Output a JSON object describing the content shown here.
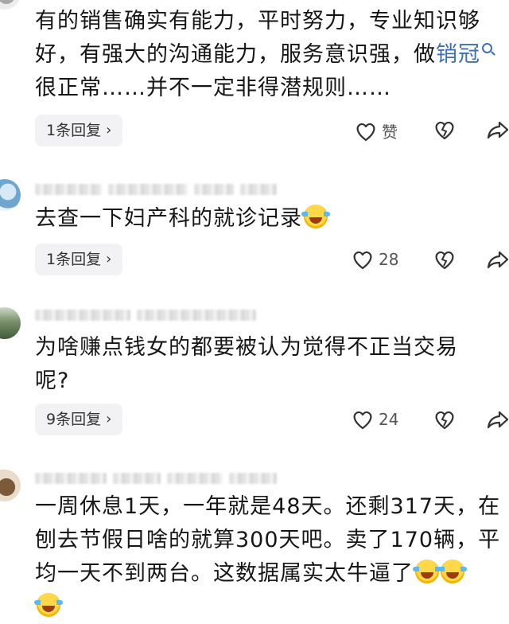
{
  "comments": [
    {
      "text_before_link": "有的销售确实有能力，平时努力，专业知识够好，有强大的沟通能力，服务意识强，做",
      "link_text": "销冠",
      "text_after_link": "很正常……并不一定非得潜规则……",
      "reply_label": "1条回复",
      "like_label": "赞"
    },
    {
      "text": "去查一下妇产科的就诊记录",
      "reply_label": "1条回复",
      "like_count": "28"
    },
    {
      "text": "为啥赚点钱女的都要被认为觉得不正当交易呢?",
      "reply_label": "9条回复",
      "like_count": "24"
    },
    {
      "text": "一周休息1天，一年就是48天。还剩317天，在刨去节假日啥的就算300天吧。卖了170辆，平均一天不到两台。这数据属实太牛逼了"
    }
  ],
  "icons": {
    "like": "heart-outline-icon",
    "dislike": "broken-heart-icon",
    "share": "share-arrow-icon",
    "reply_chevron": "chevron-right-icon",
    "emoji": "laughing-crying-emoji"
  },
  "colors": {
    "link": "#3e6fb6",
    "reply_bg": "#f2f2f4",
    "text": "#161616"
  }
}
